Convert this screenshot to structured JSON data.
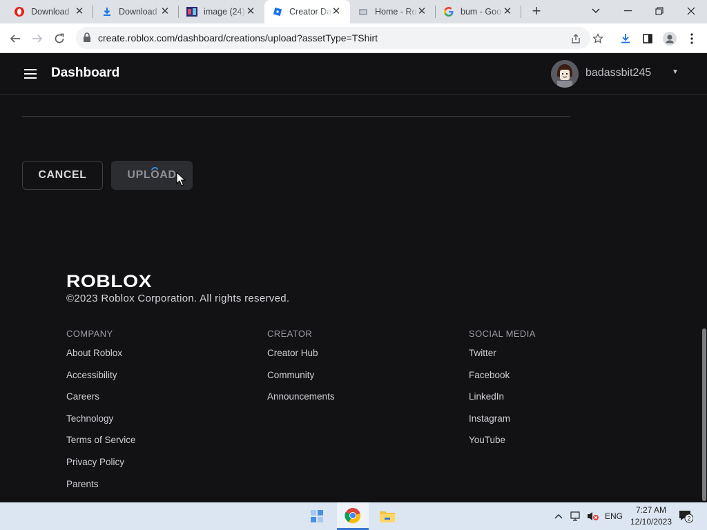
{
  "browser": {
    "tabs": [
      {
        "title": "Download",
        "active": false
      },
      {
        "title": "Download",
        "active": false
      },
      {
        "title": "image (24)",
        "active": false
      },
      {
        "title": "Creator Da",
        "active": true
      },
      {
        "title": "Home - Ro",
        "active": false
      },
      {
        "title": "bum - Goo",
        "active": false
      }
    ],
    "url": "create.roblox.com/dashboard/creations/upload?assetType=TShirt"
  },
  "header": {
    "title": "Dashboard",
    "username": "badassbit245"
  },
  "actions": {
    "cancel_label": "CANCEL",
    "upload_label": "UPLOAD"
  },
  "footer": {
    "logo_text": "ROBLOX",
    "copyright": "©2023 Roblox Corporation. All rights reserved.",
    "columns": [
      {
        "heading": "COMPANY",
        "links": [
          "About Roblox",
          "Accessibility",
          "Careers",
          "Technology",
          "Terms of Service",
          "Privacy Policy",
          "Parents"
        ]
      },
      {
        "heading": "CREATOR",
        "links": [
          "Creator Hub",
          "Community",
          "Announcements"
        ]
      },
      {
        "heading": "SOCIAL MEDIA",
        "links": [
          "Twitter",
          "Facebook",
          "LinkedIn",
          "Instagram",
          "YouTube"
        ]
      }
    ]
  },
  "taskbar": {
    "language": "ENG",
    "time": "7:27 AM",
    "date": "12/10/2023",
    "notification_count": "2"
  },
  "colors": {
    "page_bg": "#121215",
    "accent_blue": "#1a73e8",
    "spinner": "#3aa0ff"
  }
}
